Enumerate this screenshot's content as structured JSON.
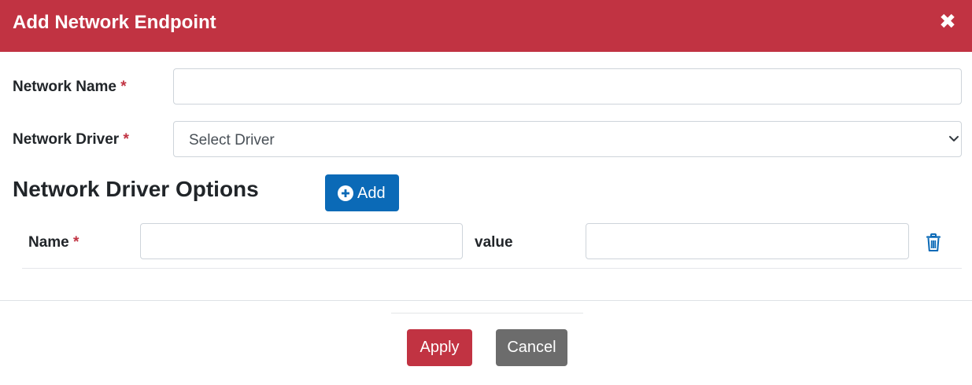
{
  "dialog": {
    "title": "Add Network Endpoint",
    "close_icon": "close-icon"
  },
  "form": {
    "network_name": {
      "label": "Network Name",
      "required_mark": "*",
      "value": "",
      "placeholder": ""
    },
    "network_driver": {
      "label": "Network Driver",
      "required_mark": "*",
      "selected": "Select Driver"
    }
  },
  "driver_options": {
    "title": "Network Driver Options",
    "add_button_label": "Add",
    "add_icon": "plus-circle-icon",
    "rows": [
      {
        "name_label": "Name",
        "required_mark": "*",
        "name_value": "",
        "value_label": "value",
        "value_value": "",
        "delete_icon": "trash-icon"
      }
    ]
  },
  "footer": {
    "apply_label": "Apply",
    "cancel_label": "Cancel"
  },
  "colors": {
    "header": "#c13342",
    "required": "#c13342",
    "primary": "#0b6ab7",
    "apply": "#c13342",
    "cancel": "#6c6c6c"
  }
}
